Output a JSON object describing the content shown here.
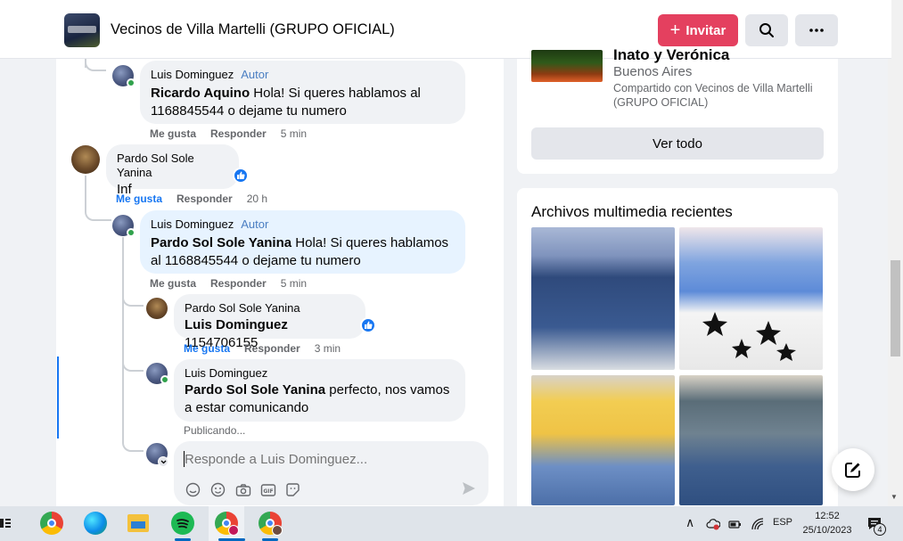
{
  "header": {
    "group_title": "Vecinos de Villa Martelli (GRUPO OFICIAL)",
    "invite_label": "Invitar",
    "search_icon": "search-icon",
    "more_icon": "more-icon"
  },
  "comments": [
    {
      "author": "Luis Dominguez",
      "author_tag": "Autor",
      "mention": "Ricardo Aquino",
      "text": "Hola! Si queres hablamos al 1168845544 o dejame tu numero",
      "like": "Me gusta",
      "reply": "Responder",
      "time": "5 min"
    },
    {
      "author": "Pardo Sol Sole Yanina",
      "text": "Inf",
      "like": "Me gusta",
      "reply": "Responder",
      "time": "20 h"
    },
    {
      "author": "Luis Dominguez",
      "author_tag": "Autor",
      "mention": "Pardo Sol Sole Yanina",
      "text": "Hola! Si queres hablamos al 1168845544 o dejame tu numero",
      "like": "Me gusta",
      "reply": "Responder",
      "time": "5 min"
    },
    {
      "author": "Pardo Sol Sole Yanina",
      "mention": "Luis Dominguez",
      "text": "1154706155",
      "like": "Me gusta",
      "reply": "Responder",
      "time": "3 min"
    },
    {
      "author": "Luis Dominguez",
      "mention": "Pardo Sol Sole Yanina",
      "text": "perfecto, nos vamos a estar comunicando",
      "status": "Publicando..."
    }
  ],
  "reply_box": {
    "placeholder": "Responde a Luis Dominguez..."
  },
  "sidebar": {
    "shared_title": "Inato y Verónica",
    "shared_location": "Buenos Aires",
    "shared_with": "Compartido con Vecinos de Villa Martelli (GRUPO OFICIAL)",
    "see_all_label": "Ver todo",
    "media_title": "Archivos multimedia recientes"
  },
  "taskbar": {
    "language": "ESP",
    "time": "12:52",
    "date": "25/10/2023",
    "notification_count": "4"
  },
  "colors": {
    "invite_button": "#e4405f",
    "link_blue": "#1877f2",
    "author_tag": "#4a7ec2",
    "reply_bubble_highlight": "#e7f3ff"
  }
}
